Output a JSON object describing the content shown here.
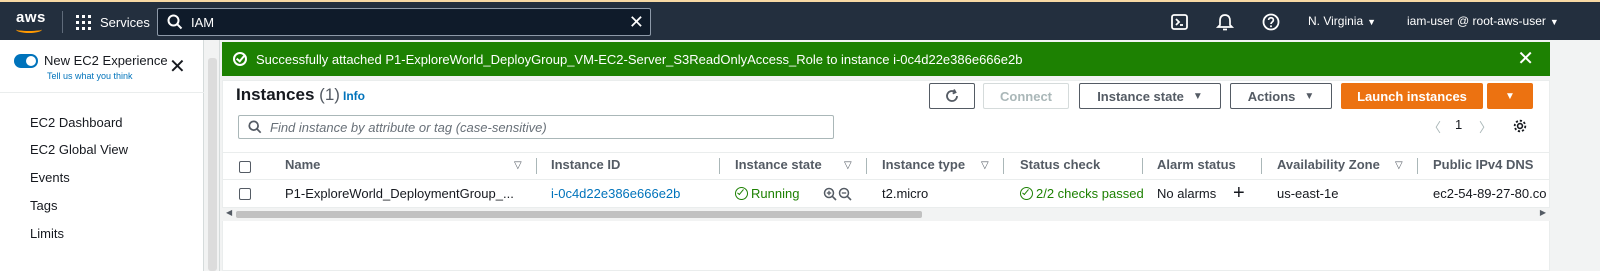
{
  "nav": {
    "logo_text": "aws",
    "services_label": "Services",
    "search_value": "IAM",
    "region": "N. Virginia",
    "user": "iam-user @ root-aws-user"
  },
  "sidebar": {
    "experience_label": "New EC2 Experience",
    "tell_us": "Tell us what you think",
    "items": [
      {
        "label": "EC2 Dashboard"
      },
      {
        "label": "EC2 Global View"
      },
      {
        "label": "Events"
      },
      {
        "label": "Tags"
      },
      {
        "label": "Limits"
      }
    ]
  },
  "flash": {
    "message": "Successfully attached P1-ExploreWorld_DeployGroup_VM-EC2-Server_S3ReadOnlyAccess_Role to instance i-0c4d22e386e666e2b"
  },
  "instances": {
    "title": "Instances",
    "count": "(1)",
    "info": "Info",
    "buttons": {
      "connect": "Connect",
      "instance_state": "Instance state",
      "actions": "Actions",
      "launch": "Launch instances"
    },
    "filter_placeholder": "Find instance by attribute or tag (case-sensitive)",
    "page": "1",
    "columns": [
      "Name",
      "Instance ID",
      "Instance state",
      "Instance type",
      "Status check",
      "Alarm status",
      "Availability Zone",
      "Public IPv4 DNS"
    ],
    "row": {
      "name": "P1-ExploreWorld_DeploymentGroup_...",
      "instance_id": "i-0c4d22e386e666e2b",
      "state": "Running",
      "type": "t2.micro",
      "status_check": "2/2 checks passed",
      "alarm": "No alarms",
      "az": "us-east-1e",
      "dns": "ec2-54-89-27-80.co"
    }
  },
  "colors": {
    "nav_bg": "#232f3e",
    "success": "#1d8102",
    "primary": "#ec7211",
    "link": "#0073bb"
  }
}
